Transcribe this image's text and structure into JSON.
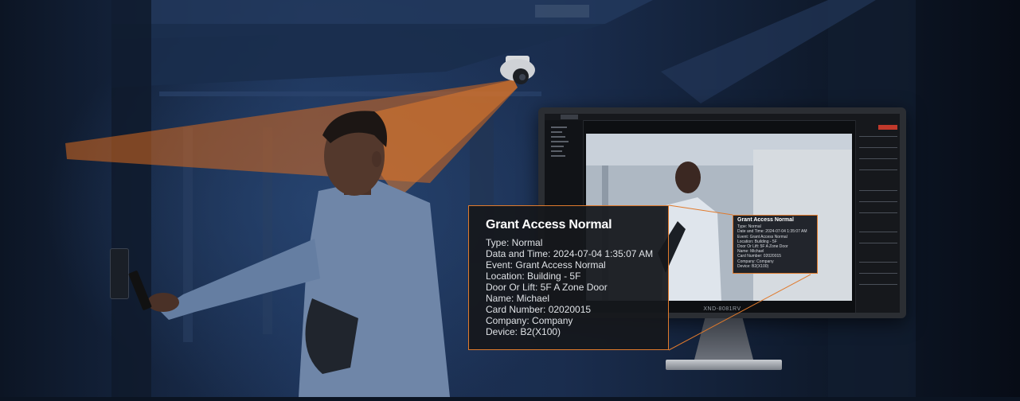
{
  "popup": {
    "title": "Grant Access Normal",
    "lines": [
      "Type: Normal",
      "Data and Time: 2024-07-04  1:35:07 AM",
      "Event: Grant Access Normal",
      "Location: Building - 5F",
      "Door Or Lift: 5F A Zone Door",
      "Name: Michael",
      "Card Number: 02020015",
      "Company: Company",
      "Device: B2(X100)"
    ]
  },
  "monitor": {
    "model_label": "XND-8081RV",
    "mini_popup": {
      "title": "Grant Access  Normal",
      "lines": [
        "Type: Normal",
        "Date and Time: 2024-07-04 1:35:07 AM",
        "Event: Grant Access Normal",
        "Location: Building - 5F",
        "Door Or Lift: 5F A Zone Door",
        "Name: Michael",
        "Card Number: 02020015",
        "Company: Company",
        "Device: B2(X100)"
      ]
    }
  },
  "colors": {
    "accent": "#e07a2c",
    "camera_beam": "#d86a1e",
    "scene_blue": "#1d3358"
  },
  "icons": {
    "camera": "dome-camera-icon",
    "card_reader": "card-reader-icon",
    "phone": "smartphone-icon"
  }
}
